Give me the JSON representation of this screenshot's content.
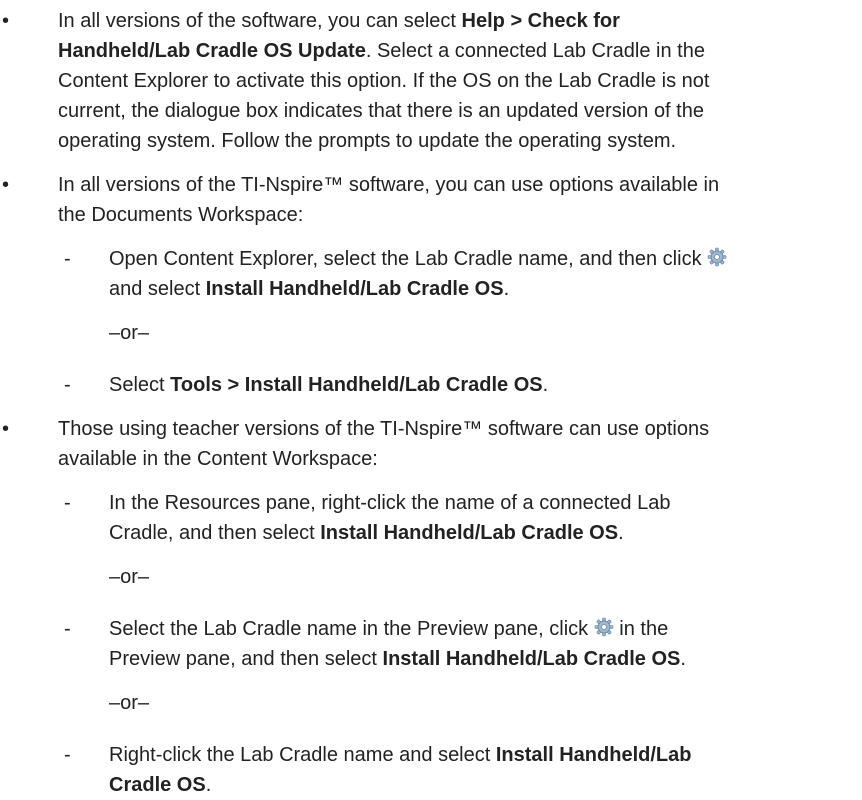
{
  "bullets": [
    {
      "marker": "•",
      "lines": [
        [
          "In all versions of the software, you can select ",
          {
            "b": "Help > Check for"
          }
        ],
        [
          {
            "b": "Handheld/Lab Cradle OS Update"
          },
          ". Select a connected Lab Cradle in the"
        ],
        [
          "Content Explorer to activate this option. If the OS on the Lab Cradle is not"
        ],
        [
          "current, the dialogue box indicates that there is an updated version of the"
        ],
        [
          "operating system. Follow the prompts to update the operating system."
        ]
      ]
    },
    {
      "marker": "•",
      "lines": [
        [
          "In all versions of the TI-Nspire™ software, you can use options available in"
        ],
        [
          "the Documents Workspace:"
        ]
      ]
    },
    {
      "marker": "-",
      "lines": [
        [
          "Open Content Explorer, select the Lab Cradle name, and then click ",
          {
            "icon": "gear"
          }
        ],
        [
          "and select ",
          {
            "b": "Install Handheld/Lab Cradle OS"
          },
          "."
        ]
      ]
    },
    {
      "or": "–or–"
    },
    {
      "marker": "-",
      "lines": [
        [
          "Select ",
          {
            "b": "Tools > Install Handheld/Lab Cradle OS"
          },
          "."
        ]
      ]
    },
    {
      "marker": "•",
      "lines": [
        [
          "Those using teacher versions of the TI-Nspire™ software can use options"
        ],
        [
          "available in the Content Workspace:"
        ]
      ]
    },
    {
      "marker": "-",
      "lines": [
        [
          "In the Resources pane, right-click the name of a connected Lab"
        ],
        [
          "Cradle, and then select ",
          {
            "b": "Install Handheld/Lab Cradle OS"
          },
          "."
        ]
      ]
    },
    {
      "or": "–or–"
    },
    {
      "marker": "-",
      "lines": [
        [
          "Select the Lab Cradle name in the Preview pane, click ",
          {
            "icon": "gear"
          },
          " in the"
        ],
        [
          "Preview pane, and then select ",
          {
            "b": "Install Handheld/Lab Cradle OS"
          },
          "."
        ]
      ]
    },
    {
      "or": "–or–"
    },
    {
      "marker": "-",
      "lines": [
        [
          "Right-click the Lab Cradle name and select ",
          {
            "b": "Install Handheld/Lab"
          }
        ],
        [
          {
            "b": "Cradle OS"
          },
          "."
        ]
      ]
    }
  ],
  "icon_colors": {
    "gear_fill": "#9fb7cf",
    "gear_stroke": "#5d7fa0",
    "gear_center": "#ffffff"
  }
}
